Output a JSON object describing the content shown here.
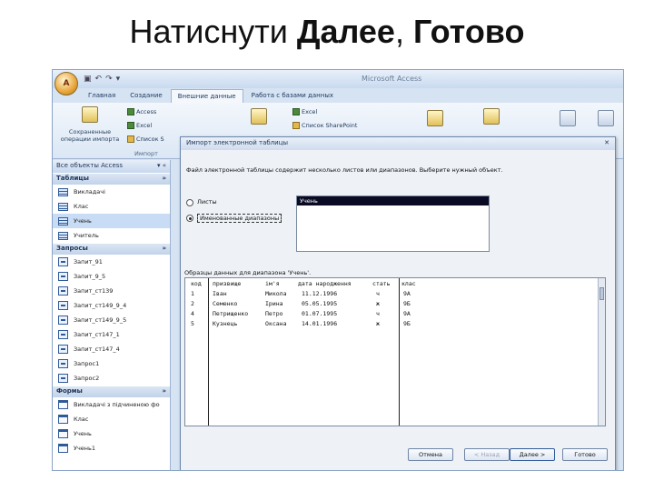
{
  "slide_title": {
    "normal": "Натиснути ",
    "bold1": "Далее",
    "sep": ", ",
    "bold2": "Готово"
  },
  "app": {
    "title": "Microsoft Access",
    "office_button": "A",
    "tabs": [
      "Главная",
      "Создание",
      "Внешние данные",
      "Работа с базами данных"
    ],
    "active_tab": 2,
    "ribbon": {
      "save_import_label": "Сохраненные операции импорта",
      "access_label": "Access",
      "excel_label": "Excel",
      "sharepoint_list_label": "Список S",
      "import_group": "Импорт",
      "export_excel_label": "Excel",
      "export_sharepoint_label": "Список SharePoint"
    }
  },
  "nav": {
    "header": "Все объекты Access",
    "sections": [
      {
        "title": "Таблицы",
        "icon": "table-icon",
        "items": [
          "Викладачі",
          "Клас",
          "Учень",
          "Учитель"
        ],
        "selected": 2
      },
      {
        "title": "Запросы",
        "icon": "query-icon",
        "items": [
          "Запит_91",
          "Запит_9_5",
          "Запит_ст139",
          "Запит_ст149_9_4",
          "Запит_ст149_9_5",
          "Запит_ст147_1",
          "Запит_ст147_4",
          "Запрос1",
          "Запрос2"
        ]
      },
      {
        "title": "Формы",
        "icon": "form-icon",
        "items": [
          "Викладачі з підчиненою фо",
          "Клас",
          "Учень",
          "Учень1"
        ]
      }
    ]
  },
  "dialog": {
    "title": "Импорт электронной таблицы",
    "prompt": "Файл электронной таблицы содержит несколько листов или диапазонов. Выберите нужный объект.",
    "radio_sheets": "Листы",
    "radio_ranges": "Именованные диапазоны",
    "list_items": [
      "Учень"
    ],
    "preview_caption": "Образцы данных для диапазона 'Учень'.",
    "grid_headers": [
      "код",
      "призвище",
      "ім'я",
      "дата народження",
      "стать",
      "клас"
    ],
    "grid_rows": [
      [
        "1",
        "Іван",
        "Микола",
        "11.12.1996",
        "ч",
        "9А"
      ],
      [
        "2",
        "Семенко",
        "Ірина",
        "05.05.1995",
        "ж",
        "9Б"
      ],
      [
        "4",
        "Петрищенко",
        "Петро",
        "01.07.1995",
        "ч",
        "9А"
      ],
      [
        "5",
        "Кузнець",
        "Оксана",
        "14.01.1996",
        "ж",
        "9Б"
      ]
    ],
    "buttons": {
      "cancel": "Отмена",
      "back": "< Назад",
      "next": "Далее >",
      "finish": "Готово"
    }
  }
}
